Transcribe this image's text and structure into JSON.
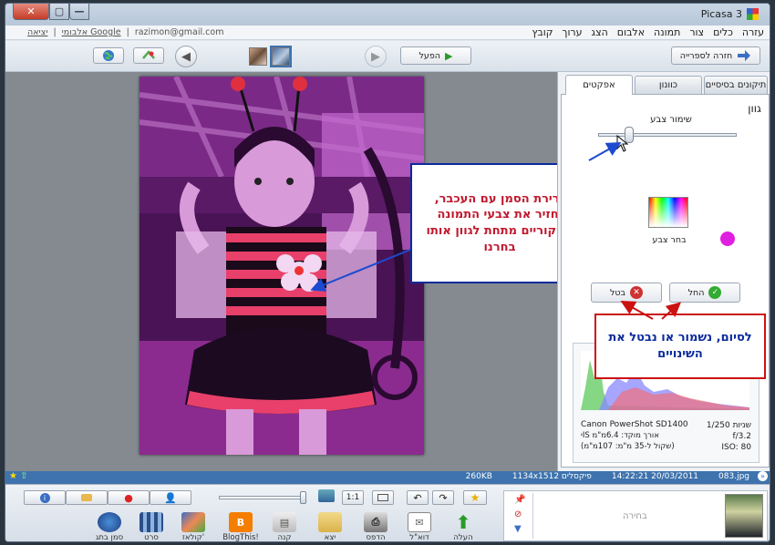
{
  "window": {
    "title": "Picasa 3",
    "controls": {
      "close": "✕",
      "maximize": "▢",
      "minimize": "—"
    }
  },
  "menu": {
    "items": [
      "קובץ",
      "ערוך",
      "הצג",
      "אלבום",
      "תמונה",
      "צור",
      "כלים",
      "עזרה"
    ]
  },
  "account": {
    "exit": "יציאה",
    "albums": "אלבומי Google",
    "email": "razimon@gmail.com"
  },
  "toolbar": {
    "back_label": "חזרה לספרייה",
    "play_label": "הפעל"
  },
  "panel": {
    "tabs": [
      "תיקונים בסיסיים",
      "כוונון",
      "אפקטים"
    ],
    "active_tab": "אפקטים",
    "effect_title": "גוון",
    "slider_label": "שימור צבע",
    "slider_value": 0.2,
    "pick_color_label": "בחר צבע",
    "selected_color": "#e020e0",
    "apply_label": "החל",
    "cancel_label": "בטל",
    "camera": "Canon PowerShot SD1400",
    "exif": [
      {
        "label": "שניות",
        "value": "1/250"
      },
      {
        "label": "",
        "value": "f/3.2"
      },
      {
        "label": "ISO:",
        "value": "80"
      }
    ],
    "focal": "אורך מוקד: 6.4מ\"מ ISי",
    "focal35": "(שקול ל-35 מ\"מ: 107מ\"מ)"
  },
  "callouts": {
    "slider": "גרירת הסמן עם העכבר, יחזיר את צבעי התמונה המקוריים מתחת לגוון אותו בחרנו",
    "finish": "לסיום, נשמור או נבטל את השינויים"
  },
  "status": {
    "filename": "083.jpg",
    "datetime": "14:22:21 20/03/2011",
    "dimensions": "1134x1512 פיקסלים",
    "filesize": "260KB"
  },
  "bottom": {
    "zoom_ratio": "1:1",
    "tray_label": "בחירה",
    "tools": [
      "העלה",
      "דוא\"ל",
      "הדפס",
      "יצא",
      "קנה",
      "BlogThis!",
      "קולאז'",
      "סרט",
      "סמן בתג"
    ]
  },
  "colors": {
    "accent": "#3e73ad",
    "tint": "#e020e0",
    "callout_border": "#0a2a9c"
  }
}
